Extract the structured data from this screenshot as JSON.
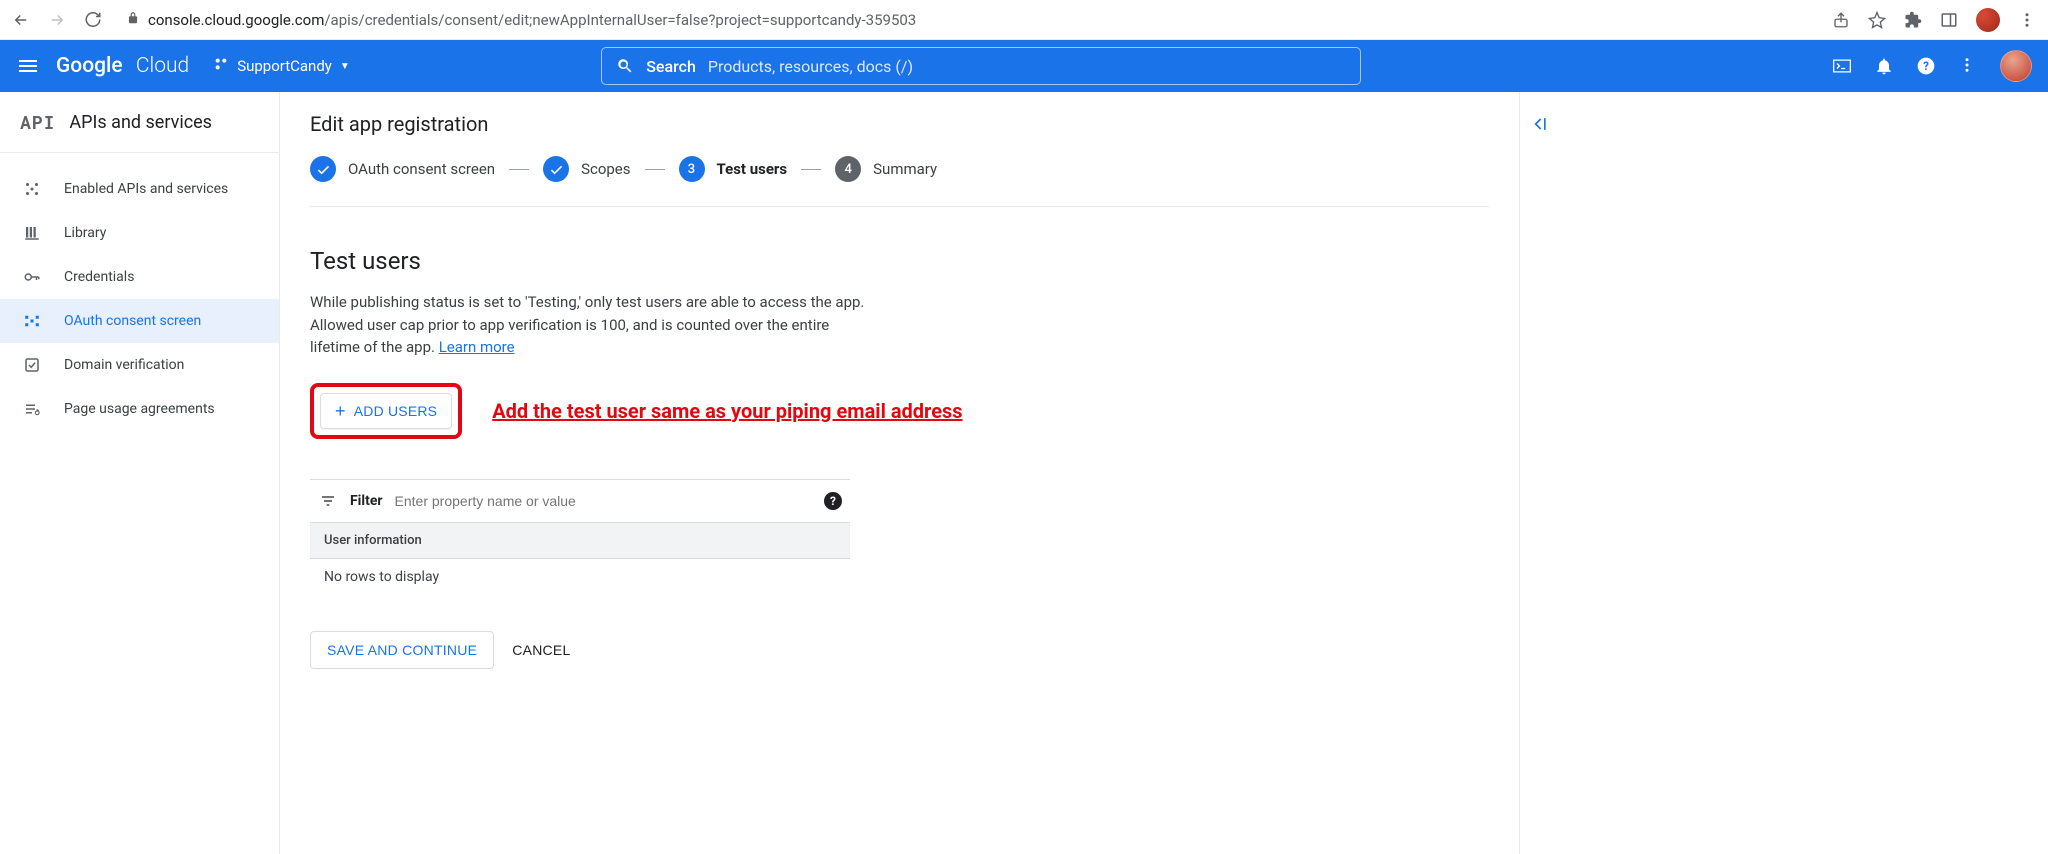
{
  "browser": {
    "url_host": "console.cloud.google.com",
    "url_path": "/apis/credentials/consent/edit;newAppInternalUser=false?project=supportcandy-359503"
  },
  "header": {
    "logo_google": "Google",
    "logo_cloud": "Cloud",
    "project_name": "SupportCandy",
    "search_label": "Search",
    "search_placeholder": "Products, resources, docs (/)"
  },
  "sidebar": {
    "badge": "API",
    "title": "APIs and services",
    "items": [
      {
        "label": "Enabled APIs and services"
      },
      {
        "label": "Library"
      },
      {
        "label": "Credentials"
      },
      {
        "label": "OAuth consent screen"
      },
      {
        "label": "Domain verification"
      },
      {
        "label": "Page usage agreements"
      }
    ]
  },
  "main": {
    "page_title": "Edit app registration",
    "steps": [
      {
        "label": "OAuth consent screen",
        "num": ""
      },
      {
        "label": "Scopes",
        "num": ""
      },
      {
        "label": "Test users",
        "num": "3"
      },
      {
        "label": "Summary",
        "num": "4"
      }
    ],
    "section_title": "Test users",
    "section_desc": "While publishing status is set to 'Testing,' only test users are able to access the app. Allowed user cap prior to app verification is 100, and is counted over the entire lifetime of the app. ",
    "learn_more": "Learn more",
    "add_users_label": "ADD USERS",
    "annotation": "Add the test user same as your piping email address",
    "filter_label": "Filter",
    "filter_placeholder": "Enter property name or value",
    "table_header": "User information",
    "table_empty": "No rows to display",
    "save_label": "SAVE AND CONTINUE",
    "cancel_label": "CANCEL"
  }
}
